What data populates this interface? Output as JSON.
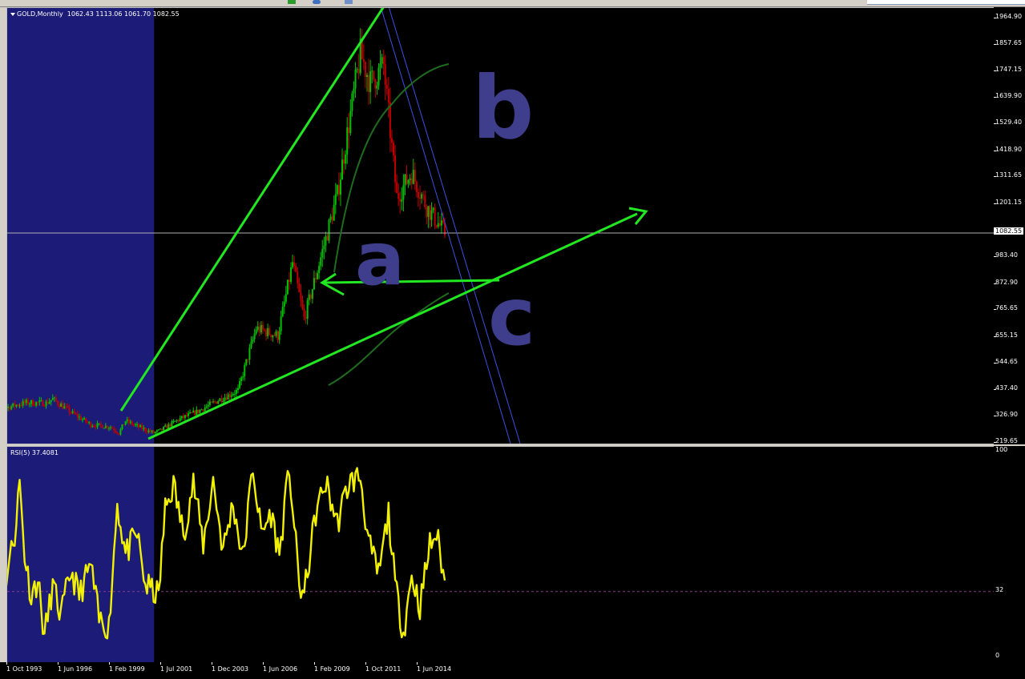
{
  "window": {
    "symbol_title": "GOLD,Monthly",
    "ohlc": "1062.43 1113.06 1061.70 1082.55"
  },
  "rsi": {
    "title": "RSI(5) 37.4081",
    "scale_labels": [
      "100",
      "32",
      "0"
    ],
    "level": 32
  },
  "price_scale": {
    "labels": [
      "1964.90",
      "1857.65",
      "1747.15",
      "1639.90",
      "1529.40",
      "1418.90",
      "1311.65",
      "1201.15",
      "983.40",
      "872.90",
      "765.65",
      "655.15",
      "544.65",
      "437.40",
      "326.90",
      "219.65"
    ],
    "current_price": "1082.55"
  },
  "time_axis": {
    "labels": [
      "1 Oct 1993",
      "1 Jun 1996",
      "1 Feb 1999",
      "1 Jul 2001",
      "1 Dec 2003",
      "1 Jun 2006",
      "1 Feb 2009",
      "1 Oct 2011",
      "1 Jun 2014"
    ]
  },
  "colors": {
    "background": "#000000",
    "bull_candle": "#00c000",
    "bear_candle": "#c00000",
    "highlight_zone": "#1c1c78",
    "trendline": "#22e822",
    "channel_line": "#3a50e0",
    "arc": "#1e6b1e",
    "rsi_line": "#f2f200",
    "annotation": "#3e3e8c",
    "grid_line": "#b0b0b0"
  },
  "annotations": {
    "handwritten": [
      "b",
      "a",
      "c"
    ]
  },
  "chart_data": [
    {
      "type": "candlestick",
      "title": "GOLD,Monthly",
      "x_range": [
        "1992-10",
        "2015-11"
      ],
      "ylim": [
        219.65,
        1964.9
      ],
      "price_series": [
        {
          "date": "1992-10",
          "close": 350
        },
        {
          "date": "1993-10",
          "close": 365
        },
        {
          "date": "1994-10",
          "close": 385
        },
        {
          "date": "1995-10",
          "close": 383
        },
        {
          "date": "1996-02",
          "close": 400
        },
        {
          "date": "1997-01",
          "close": 345
        },
        {
          "date": "1998-01",
          "close": 295
        },
        {
          "date": "1999-01",
          "close": 285
        },
        {
          "date": "1999-06",
          "close": 260
        },
        {
          "date": "1999-10",
          "close": 310
        },
        {
          "date": "2000-06",
          "close": 285
        },
        {
          "date": "2001-03",
          "close": 260
        },
        {
          "date": "2001-07",
          "close": 270
        },
        {
          "date": "2002-06",
          "close": 315
        },
        {
          "date": "2003-06",
          "close": 350
        },
        {
          "date": "2004-06",
          "close": 395
        },
        {
          "date": "2005-06",
          "close": 435
        },
        {
          "date": "2006-05",
          "close": 690
        },
        {
          "date": "2007-06",
          "close": 660
        },
        {
          "date": "2008-03",
          "close": 960
        },
        {
          "date": "2008-10",
          "close": 730
        },
        {
          "date": "2009-06",
          "close": 930
        },
        {
          "date": "2010-06",
          "close": 1240
        },
        {
          "date": "2011-08",
          "close": 1820
        },
        {
          "date": "2012-02",
          "close": 1700
        },
        {
          "date": "2012-10",
          "close": 1770
        },
        {
          "date": "2013-06",
          "close": 1230
        },
        {
          "date": "2014-03",
          "close": 1330
        },
        {
          "date": "2014-12",
          "close": 1190
        },
        {
          "date": "2015-11",
          "close": 1082.55
        }
      ]
    },
    {
      "type": "line",
      "title": "RSI(5) 37.4081",
      "ylim": [
        0,
        100
      ],
      "rsi_series": [
        {
          "date": "1992-10",
          "value": 75
        },
        {
          "date": "1993-02",
          "value": 55
        },
        {
          "date": "1993-06",
          "value": 68
        },
        {
          "date": "1993-10",
          "value": 40
        },
        {
          "date": "1994-03",
          "value": 60
        },
        {
          "date": "1994-06",
          "value": 85
        },
        {
          "date": "1994-09",
          "value": 50
        },
        {
          "date": "1995-01",
          "value": 30
        },
        {
          "date": "1995-05",
          "value": 38
        },
        {
          "date": "1995-09",
          "value": 10
        },
        {
          "date": "1996-02",
          "value": 35
        },
        {
          "date": "1996-07",
          "value": 20
        },
        {
          "date": "1997-01",
          "value": 42
        },
        {
          "date": "1997-06",
          "value": 30
        },
        {
          "date": "1998-01",
          "value": 45
        },
        {
          "date": "1998-06",
          "value": 18
        },
        {
          "date": "1998-12",
          "value": 15
        },
        {
          "date": "1999-05",
          "value": 75
        },
        {
          "date": "1999-10",
          "value": 50
        },
        {
          "date": "2000-05",
          "value": 60
        },
        {
          "date": "2000-10",
          "value": 35
        },
        {
          "date": "2001-06",
          "value": 30
        },
        {
          "date": "2001-10",
          "value": 72
        },
        {
          "date": "2002-03",
          "value": 84
        },
        {
          "date": "2002-09",
          "value": 60
        },
        {
          "date": "2003-03",
          "value": 85
        },
        {
          "date": "2003-09",
          "value": 55
        },
        {
          "date": "2004-03",
          "value": 86
        },
        {
          "date": "2004-09",
          "value": 52
        },
        {
          "date": "2005-03",
          "value": 75
        },
        {
          "date": "2005-09",
          "value": 48
        },
        {
          "date": "2006-03",
          "value": 93
        },
        {
          "date": "2006-08",
          "value": 60
        },
        {
          "date": "2007-02",
          "value": 70
        },
        {
          "date": "2007-07",
          "value": 50
        },
        {
          "date": "2008-01",
          "value": 92
        },
        {
          "date": "2008-07",
          "value": 35
        },
        {
          "date": "2008-10",
          "value": 30
        },
        {
          "date": "2009-05",
          "value": 70
        },
        {
          "date": "2009-11",
          "value": 85
        },
        {
          "date": "2010-06",
          "value": 65
        },
        {
          "date": "2011-01",
          "value": 85
        },
        {
          "date": "2011-08",
          "value": 88
        },
        {
          "date": "2012-01",
          "value": 55
        },
        {
          "date": "2012-07",
          "value": 40
        },
        {
          "date": "2013-01",
          "value": 70
        },
        {
          "date": "2013-05",
          "value": 35
        },
        {
          "date": "2013-10",
          "value": 12
        },
        {
          "date": "2014-03",
          "value": 40
        },
        {
          "date": "2014-08",
          "value": 25
        },
        {
          "date": "2015-02",
          "value": 55
        },
        {
          "date": "2015-06",
          "value": 60
        },
        {
          "date": "2015-11",
          "value": 37.4
        }
      ]
    }
  ]
}
